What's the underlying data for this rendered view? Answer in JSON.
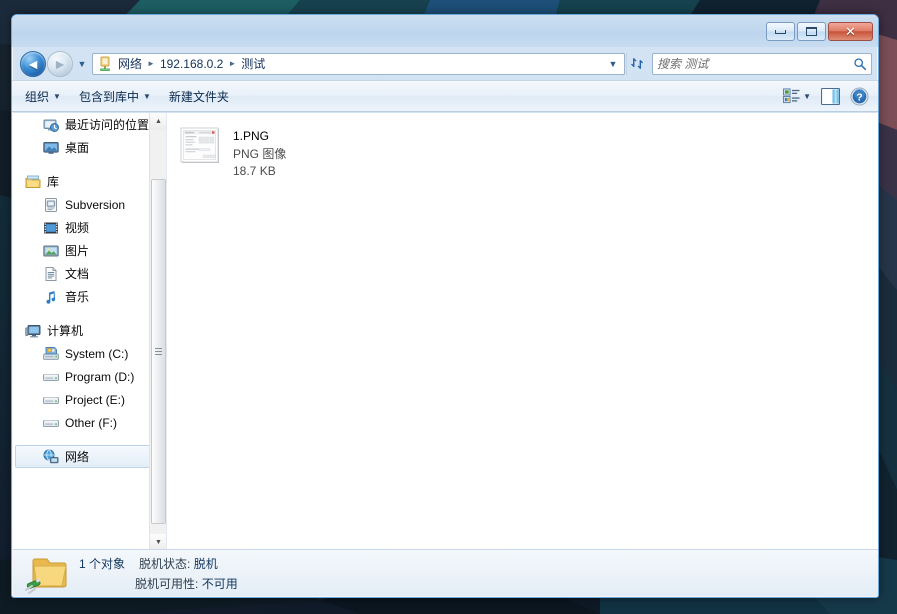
{
  "window": {
    "title": "",
    "controls": {
      "minimize_label": "最小化",
      "maximize_label": "最大化",
      "close_label": "关闭",
      "close_glyph": "✕"
    }
  },
  "navigation": {
    "back_label": "后退",
    "back_glyph": "◄",
    "forward_label": "前进",
    "forward_glyph": "►",
    "history_dropdown_glyph": "▼",
    "refresh_glyph": "↯",
    "refresh_label": "刷新"
  },
  "address": {
    "icon": "network-share-icon",
    "separator": "►",
    "dropdown_glyph": "▼",
    "crumbs": [
      {
        "label": "网络"
      },
      {
        "label": "192.168.0.2"
      },
      {
        "label": "测试"
      }
    ]
  },
  "search": {
    "placeholder": "搜索 测试",
    "icon": "search-icon",
    "icon_glyph": "🔍"
  },
  "commandbar": {
    "organize_label": "组织",
    "include_in_library_label": "包含到库中",
    "new_folder_label": "新建文件夹",
    "caret_glyph": "▼",
    "change_view_label": "更改您的视图",
    "preview_pane_label": "显示预览窗格",
    "help_label": "获取帮助",
    "help_glyph": "?"
  },
  "sidebar": {
    "items": [
      {
        "label": "最近访问的位置",
        "icon": "recent-places-icon",
        "level": "child",
        "selected": false
      },
      {
        "label": "桌面",
        "icon": "desktop-icon",
        "level": "child",
        "selected": false
      },
      {
        "label": "",
        "icon": "",
        "level": "gap",
        "selected": false
      },
      {
        "label": "库",
        "icon": "library-icon",
        "level": "group",
        "selected": false
      },
      {
        "label": "Subversion",
        "icon": "subversion-icon",
        "level": "child",
        "selected": false
      },
      {
        "label": "视频",
        "icon": "videos-icon",
        "level": "child",
        "selected": false
      },
      {
        "label": "图片",
        "icon": "pictures-icon",
        "level": "child",
        "selected": false
      },
      {
        "label": "文档",
        "icon": "documents-icon",
        "level": "child",
        "selected": false
      },
      {
        "label": "音乐",
        "icon": "music-icon",
        "level": "child",
        "selected": false
      },
      {
        "label": "",
        "icon": "",
        "level": "gap",
        "selected": false
      },
      {
        "label": "计算机",
        "icon": "computer-icon",
        "level": "group",
        "selected": false
      },
      {
        "label": "System (C:)",
        "icon": "system-drive-icon",
        "level": "child",
        "selected": false
      },
      {
        "label": "Program (D:)",
        "icon": "drive-icon",
        "level": "child",
        "selected": false
      },
      {
        "label": "Project (E:)",
        "icon": "drive-icon",
        "level": "child",
        "selected": false
      },
      {
        "label": "Other (F:)",
        "icon": "drive-icon",
        "level": "child",
        "selected": false
      },
      {
        "label": "",
        "icon": "",
        "level": "gap",
        "selected": false
      },
      {
        "label": "网络",
        "icon": "network-icon",
        "level": "group",
        "selected": true
      }
    ],
    "scrollbar": {
      "up_glyph": "▲",
      "down_glyph": "▼"
    }
  },
  "files": [
    {
      "name": "1.PNG",
      "type": "PNG 图像",
      "size": "18.7 KB",
      "icon": "png-thumbnail"
    }
  ],
  "statusbar": {
    "icon": "offline-folder-icon",
    "count": "1 个对象",
    "offline_status_label": "脱机状态:",
    "offline_status_value": "脱机",
    "offline_availability_label": "脱机可用性:",
    "offline_availability_value": "不可用"
  },
  "colors": {
    "accent": "#2a6db0",
    "window_border": "#6ea8d8",
    "close_button": "#c8543a",
    "selection": "#e3eef8",
    "desktop_dark": "#10202b"
  }
}
